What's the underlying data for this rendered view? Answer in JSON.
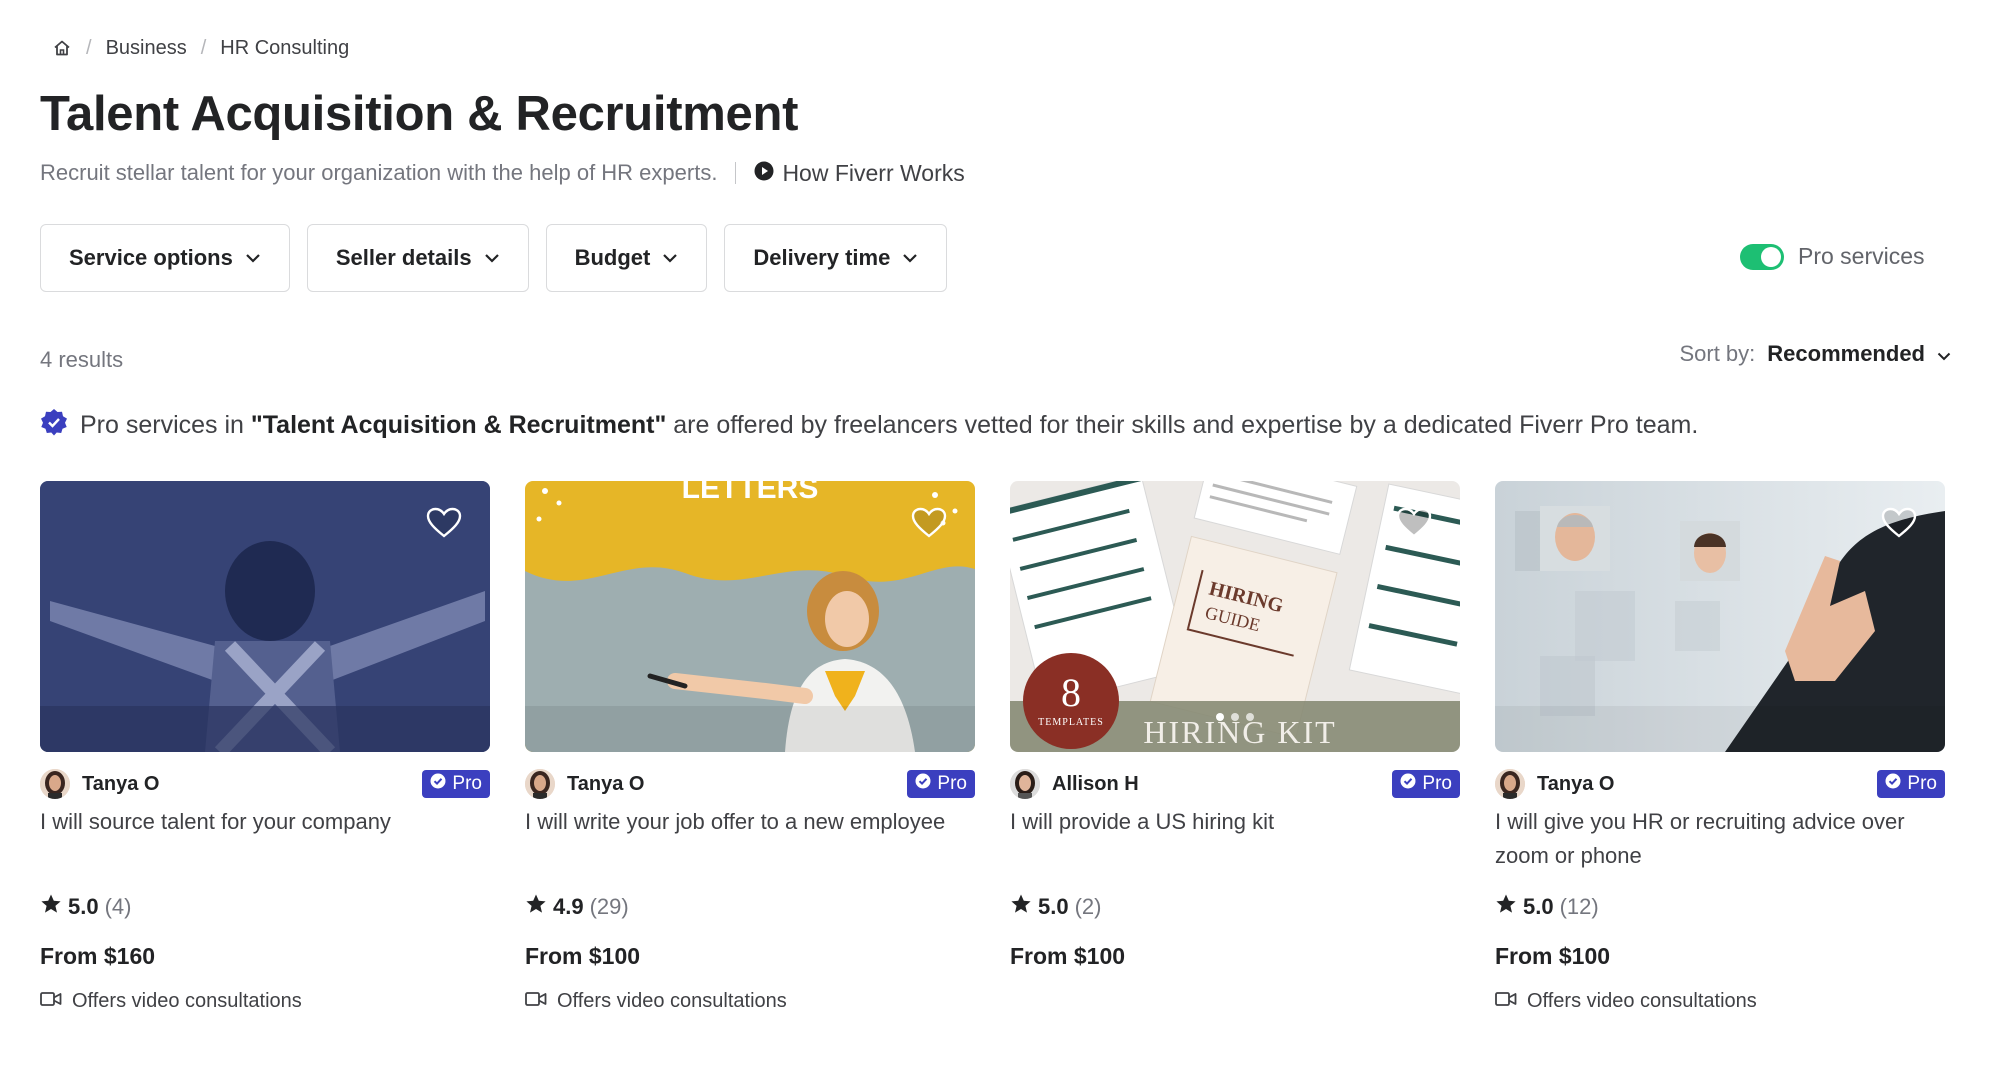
{
  "breadcrumb": {
    "home_icon": "home-icon",
    "items": [
      "Business",
      "HR Consulting"
    ]
  },
  "page": {
    "title": "Talent Acquisition & Recruitment",
    "subtitle": "Recruit stellar talent for your organization with the help of HR experts.",
    "how_link": "How Fiverr Works"
  },
  "filters": {
    "service_options": "Service options",
    "seller_details": "Seller details",
    "budget": "Budget",
    "delivery_time": "Delivery time"
  },
  "pro_toggle": {
    "label": "Pro services",
    "on": true
  },
  "results": {
    "count_label": "4 results"
  },
  "sort": {
    "label": "Sort by:",
    "value": "Recommended"
  },
  "pro_notice": {
    "prefix": "Pro services in ",
    "category": "\"Talent Acquisition & Recruitment\"",
    "suffix": " are offered by freelancers vetted for their skills and expertise by a dedicated Fiverr Pro team."
  },
  "colors": {
    "accent_green": "#1dbf73",
    "pro_purple": "#3b3fbf"
  },
  "gigs": [
    {
      "seller": "Tanya O",
      "badge": "Pro",
      "title": "I will source talent for your company",
      "rating": "5.0",
      "reviews": "(4)",
      "price": "From $160",
      "video": "Offers video consultations"
    },
    {
      "seller": "Tanya O",
      "badge": "Pro",
      "title": "I will write your job offer to a new employee",
      "rating": "4.9",
      "reviews": "(29)",
      "price": "From $100",
      "video": "Offers video consultations",
      "thumb_text": "LETTERS"
    },
    {
      "seller": "Allison H",
      "badge": "Pro",
      "title": "I will provide a US hiring kit",
      "rating": "5.0",
      "reviews": "(2)",
      "price": "From $100",
      "video": "",
      "thumb_text": {
        "guide_1": "HIRING",
        "guide_2": "GUIDE",
        "number": "8",
        "templates": "TEMPLATES",
        "kit": "HIRING KIT"
      }
    },
    {
      "seller": "Tanya O",
      "badge": "Pro",
      "title": "I will give you HR or recruiting advice over zoom or phone",
      "rating": "5.0",
      "reviews": "(12)",
      "price": "From $100",
      "video": "Offers video consultations"
    }
  ]
}
